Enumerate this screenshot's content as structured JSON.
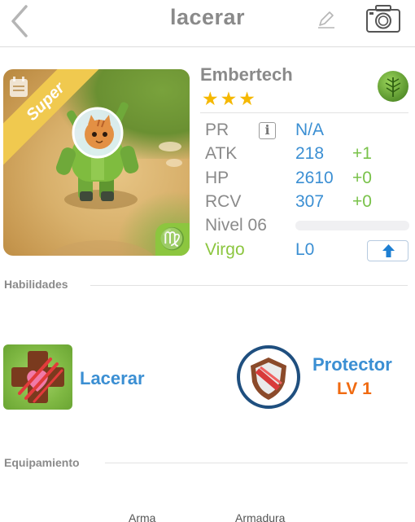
{
  "header": {
    "title": "lacerar"
  },
  "monster": {
    "name": "Embertech",
    "rarity_label": "Super",
    "stars": "★★★",
    "zodiac_symbol": "♍",
    "element_icon": "leaf-icon"
  },
  "stats": {
    "pr": {
      "label": "PR",
      "value": "N/A"
    },
    "atk": {
      "label": "ATK",
      "value": "218",
      "bonus": "+1"
    },
    "hp": {
      "label": "HP",
      "value": "2610",
      "bonus": "+0"
    },
    "rcv": {
      "label": "RCV",
      "value": "307",
      "bonus": "+0"
    },
    "level": {
      "label": "Nivel 06",
      "progress": 0
    },
    "sign": {
      "label": "Virgo",
      "value": "L0"
    }
  },
  "sections": {
    "skills": "Habilidades",
    "equipment": "Equipamiento"
  },
  "skills": {
    "active": {
      "name": "Lacerar"
    },
    "passive": {
      "name": "Protector",
      "level": "LV 1"
    }
  },
  "equipment": {
    "weapon": "Arma",
    "armor": "Armadura"
  },
  "colors": {
    "accent": "#3b8fd3",
    "bonus": "#79c24a",
    "sign": "#8cc63f",
    "level": "#f06a10",
    "stars": "#f5b800"
  }
}
